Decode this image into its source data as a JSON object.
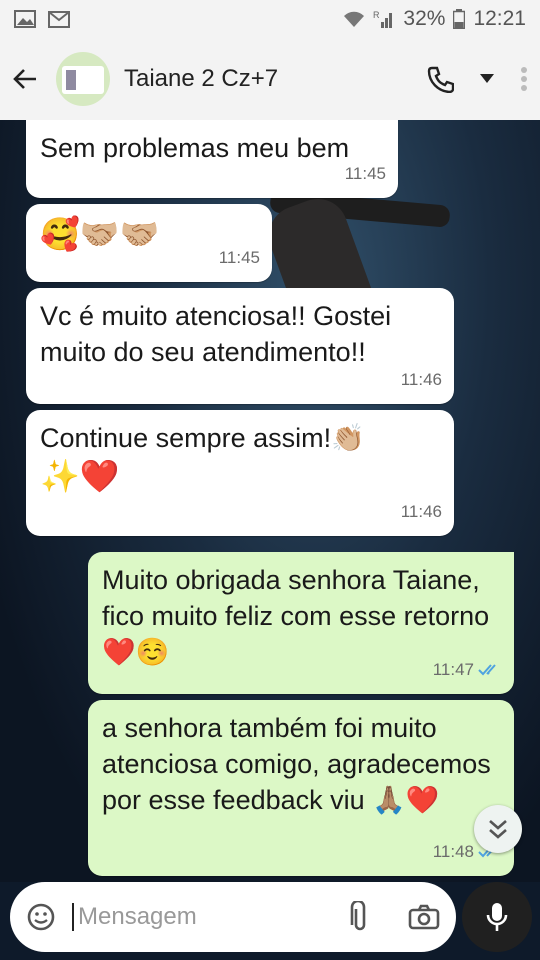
{
  "status_bar": {
    "battery": "32%",
    "time": "12:21",
    "network_tag": "R"
  },
  "header": {
    "contact_name": "Taiane 2 Cz+7"
  },
  "messages": [
    {
      "direction": "in",
      "text": "Sem problemas meu bem",
      "time": "11:45"
    },
    {
      "direction": "in",
      "text": "🥰🤝🏼🤝🏼",
      "time": "11:45"
    },
    {
      "direction": "in",
      "text": "Vc é muito atenciosa!! Gostei muito do seu atendimento!!",
      "time": "11:46"
    },
    {
      "direction": "in",
      "text": "Continue sempre assim!👏🏼",
      "text2": "✨❤️",
      "time": "11:46"
    },
    {
      "direction": "out",
      "text": "Muito obrigada senhora Taiane, fico muito feliz com esse retorno ❤️☺️",
      "time": "11:47",
      "status": "read"
    },
    {
      "direction": "out",
      "text": "a senhora também foi muito atenciosa comigo, agradecemos por esse feedback viu 🙏🏽❤️",
      "time": "11:48",
      "status": "read"
    }
  ],
  "composer": {
    "placeholder": "Mensagem"
  },
  "colors": {
    "incoming_bubble": "#ffffff",
    "outgoing_bubble": "#dcf8c6",
    "read_ticks": "#4fa3e0"
  }
}
